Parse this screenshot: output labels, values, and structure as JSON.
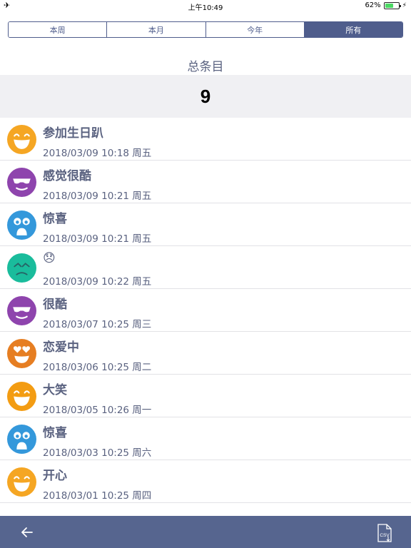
{
  "status_bar": {
    "airplane_icon": "airplane-icon",
    "time": "上午10:49",
    "battery_text": "62%",
    "battery_level": 0.62,
    "battery_color": "#4cd964",
    "charging_icon": "bolt-icon"
  },
  "segments": [
    {
      "label": "本周",
      "active": false
    },
    {
      "label": "本月",
      "active": false
    },
    {
      "label": "今年",
      "active": false
    },
    {
      "label": "所有",
      "active": true
    }
  ],
  "summary": {
    "title": "总条目",
    "count": "9"
  },
  "entries": [
    {
      "title": "参加生日趴",
      "date": "2018/03/09 10:18 周五",
      "mood": "big-smile",
      "color": "#f5a623"
    },
    {
      "title": "感觉很酷",
      "date": "2018/03/09 10:21 周五",
      "mood": "cool",
      "color": "#8e44ad"
    },
    {
      "title": "惊喜",
      "date": "2018/03/09 10:21 周五",
      "mood": "surprised",
      "color": "#3498db"
    },
    {
      "title": "😞",
      "date": "2018/03/09 10:22 周五",
      "mood": "sad",
      "color": "#1abc9c"
    },
    {
      "title": "很酷",
      "date": "2018/03/07 10:25 周三",
      "mood": "cool",
      "color": "#8e44ad"
    },
    {
      "title": "恋爱中",
      "date": "2018/03/06 10:25 周二",
      "mood": "in-love",
      "color": "#e67e22"
    },
    {
      "title": "大笑",
      "date": "2018/03/05 10:26 周一",
      "mood": "laugh",
      "color": "#f39c12"
    },
    {
      "title": "惊喜",
      "date": "2018/03/03 10:25 周六",
      "mood": "surprised",
      "color": "#3498db"
    },
    {
      "title": "开心",
      "date": "2018/03/01 10:25 周四",
      "mood": "big-smile",
      "color": "#f5a623"
    }
  ],
  "toolbar": {
    "back_icon": "back-arrow-icon",
    "export_icon": "csv-export-icon",
    "export_label": "CSV",
    "background": "#56658f"
  },
  "colors": {
    "accent": "#4f5d8c",
    "text": "#5a6280",
    "band": "#f0f0f3"
  }
}
